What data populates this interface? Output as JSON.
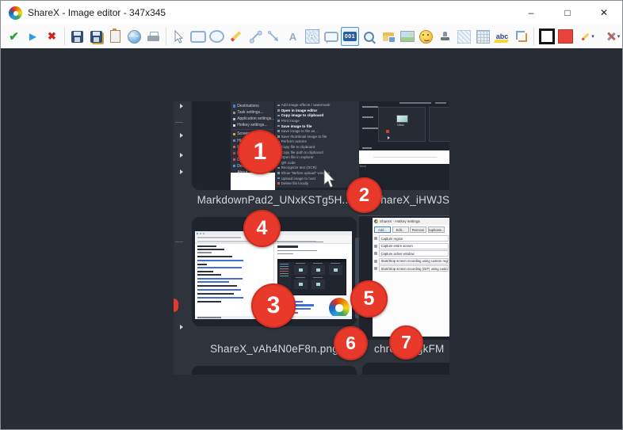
{
  "window": {
    "title": "ShareX - Image editor - 347x345",
    "controls": {
      "minimize": "–",
      "maximize": "□",
      "close": "✕"
    }
  },
  "toolbar": {
    "step_label": "001",
    "highlight_label": "abc",
    "tools": [
      "apply",
      "continue",
      "cancel",
      "save",
      "save-as",
      "copy-to-clipboard",
      "upload",
      "print",
      "select",
      "rectangle",
      "ellipse",
      "freehand",
      "line",
      "arrow",
      "text",
      "text-background",
      "speech-bubble",
      "step-number",
      "magnify",
      "image-file",
      "image",
      "emoji",
      "cursor-stamp",
      "blur",
      "pixelate",
      "highlight",
      "crop",
      "border-color",
      "fill-color",
      "pencil-options",
      "tools-menu",
      "image-options"
    ],
    "selected_tool": "step-number",
    "fill_color": "#e8443c"
  },
  "image": {
    "captions": [
      "MarkdownPad2_UNxKSTg5H...",
      "ShareX_iHWJS",
      "ShareX_vAh4N0eF8n.png",
      "chrome_gkFM"
    ],
    "tray_menu": {
      "items": [
        "Destinations",
        "Task settings...",
        "Application settings...",
        "Hotkey settings...",
        "Screenshots folder...",
        "History...",
        "Image history...",
        "News",
        "Debug",
        "Donate...",
        "About..."
      ]
    },
    "context_submenu": {
      "items": [
        "Add image effects / watermark",
        "Open in image editor",
        "Copy image to clipboard",
        "Print image",
        "Save image to file",
        "Save image to file as...",
        "Save thumbnail image to file",
        "Perform actions",
        "Copy file to clipboard",
        "Copy file path to clipboard",
        "Open file in explorer",
        "QR code",
        "Recognize text (OCR)",
        "Show \"Before upload\" window",
        "Upload image to host",
        "Delete file locally"
      ]
    },
    "window_preview": {
      "view_label": "View",
      "about_fragment": "bout"
    },
    "hotkey_window": {
      "title": "ShareX - Hotkey settings",
      "buttons": [
        "Add...",
        "Edit...",
        "Remove",
        "Duplicate..."
      ],
      "rows": [
        "Capture region",
        "Capture entire screen",
        "Capture active window",
        "Start/Stop screen recording using custom region",
        "Start/Stop screen recording (GIF) using custom region"
      ]
    }
  },
  "annotations": {
    "steps": [
      "1",
      "2",
      "3",
      "4",
      "5",
      "6",
      "7"
    ]
  },
  "colors": {
    "step_red": "#e8392b",
    "canvas_background": "#282c34",
    "selection_blue": "#3e9ad8"
  }
}
